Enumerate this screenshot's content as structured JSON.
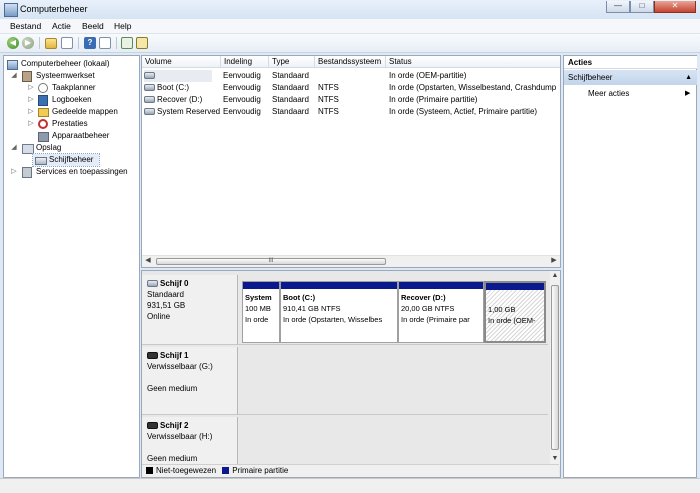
{
  "window": {
    "title": "Computerbeheer",
    "min": "—",
    "max": "□",
    "close": "✕"
  },
  "menu": [
    "Bestand",
    "Actie",
    "Beeld",
    "Help"
  ],
  "tree": {
    "root": "Computerbeheer (lokaal)",
    "systeemwerkset": "Systeemwerkset",
    "taakplanner": "Taakplanner",
    "logboeken": "Logboeken",
    "gedeelde_mappen": "Gedeelde mappen",
    "prestaties": "Prestaties",
    "apparaatbeheer": "Apparaatbeheer",
    "opslag": "Opslag",
    "schijfbeheer": "Schijfbeheer",
    "services": "Services en toepassingen"
  },
  "volume_table": {
    "columns": [
      "Volume",
      "Indeling",
      "Type",
      "Bestandssysteem",
      "Status"
    ],
    "rows": [
      [
        "",
        "Eenvoudig",
        "Standaard",
        "",
        "In orde (OEM-partitie)"
      ],
      [
        "Boot (C:)",
        "Eenvoudig",
        "Standaard",
        "NTFS",
        "In orde (Opstarten, Wisselbestand, Crashdump"
      ],
      [
        "Recover (D:)",
        "Eenvoudig",
        "Standaard",
        "NTFS",
        "In orde (Primaire partitie)"
      ],
      [
        "System Reserved",
        "Eenvoudig",
        "Standaard",
        "NTFS",
        "In orde (Systeem, Actief, Primaire partitie)"
      ]
    ],
    "scroll_grip": "III"
  },
  "disks": [
    {
      "name": "Schijf 0",
      "line1": "Standaard",
      "line2": "931,51 GB",
      "line3": "Online"
    },
    {
      "name": "Schijf 1",
      "line1": "Verwisselbaar (G:)",
      "line2": "",
      "line3": "Geen medium"
    },
    {
      "name": "Schijf 2",
      "line1": "Verwisselbaar (H:)",
      "line2": "",
      "line3": "Geen medium"
    }
  ],
  "partitions": [
    {
      "name": "System",
      "size": "100 MB",
      "status": "In orde"
    },
    {
      "name": "Boot  (C:)",
      "size": "910,41 GB NTFS",
      "status": "In orde (Opstarten, Wisselbes"
    },
    {
      "name": "Recover  (D:)",
      "size": "20,00 GB NTFS",
      "status": "In orde (Primaire par"
    },
    {
      "name": "",
      "size": "1,00 GB",
      "status": "In orde (OEM-"
    }
  ],
  "legend": {
    "unallocated": "Niet-toegewezen",
    "primary": "Primaire partitie"
  },
  "colors": {
    "primary_partition": "#0a1a8c",
    "unallocated": "#000000",
    "selection": "#c3d5ec"
  },
  "actions": {
    "title": "Acties",
    "section": "Schijfbeheer",
    "more": "Meer acties",
    "collapse": "▲",
    "arrow": "▶"
  }
}
